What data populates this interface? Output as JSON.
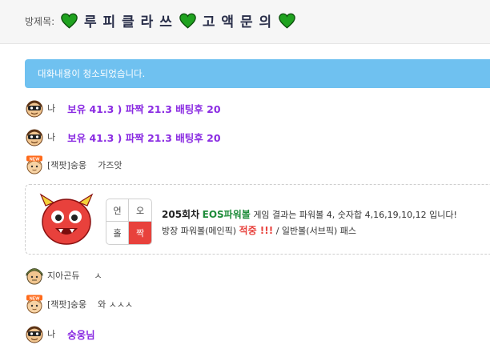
{
  "header": {
    "label": "방제목:",
    "title_parts": [
      "루 피 클 라 쓰",
      "고 액 문 의"
    ]
  },
  "notice": "대화내용이 청소되었습니다.",
  "messages": [
    {
      "nick": "나",
      "text": "보유 41.3 ) 파짝 21.3 배팅후 20"
    },
    {
      "nick": "나",
      "text": "보유 41.3 ) 파짝 21.3 배팅후 20"
    },
    {
      "nick": "[잭팟]숭웅",
      "text": "가즈앗"
    },
    {
      "nick": "지아곤듀",
      "text": "ㅅ"
    },
    {
      "nick": "[잭팟]숭웅",
      "text": "와 ㅅㅅㅅ"
    },
    {
      "nick": "나",
      "text": "숭웅님"
    }
  ],
  "result_card": {
    "grid": [
      "언",
      "오",
      "홀",
      "짝"
    ],
    "round": "205회차",
    "game": "EOS파워볼",
    "line1_rest": "게임 결과는 파워볼 4, 숫자합 4,16,19,10,12 입니다!",
    "line2_pre": "방장 파워볼(메인픽)",
    "hit": "적중 !!!",
    "line2_post": "/ 일반볼(서브픽) 패스"
  },
  "colors": {
    "notice_bg": "#6fc1f0",
    "heart": "#1fa21f",
    "purple_text": "#8a2be2",
    "highlight_red": "#e8413c"
  }
}
